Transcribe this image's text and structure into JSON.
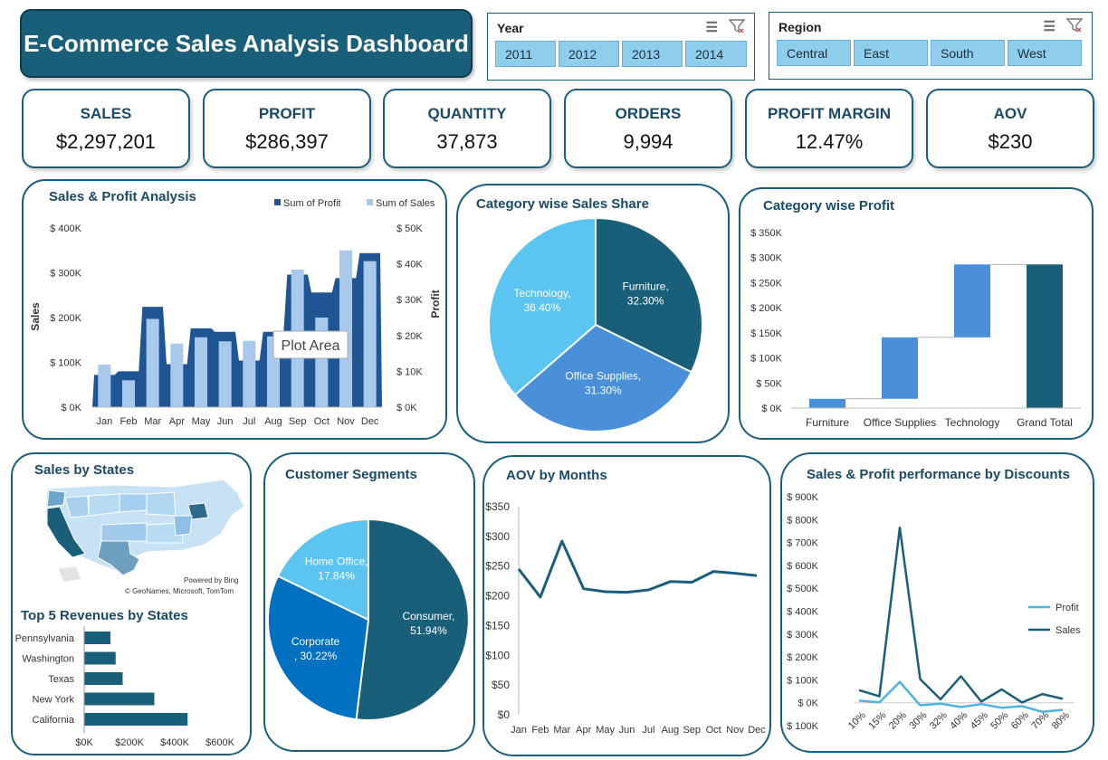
{
  "header": {
    "title": "E-Commerce Sales Analysis Dashboard"
  },
  "slicers": {
    "year": {
      "label": "Year",
      "items": [
        "2011",
        "2012",
        "2013",
        "2014"
      ]
    },
    "region": {
      "label": "Region",
      "items": [
        "Central",
        "East",
        "South",
        "West"
      ]
    }
  },
  "kpis": [
    {
      "label": "SALES",
      "value": "$2,297,201"
    },
    {
      "label": "PROFIT",
      "value": "$286,397"
    },
    {
      "label": "QUANTITY",
      "value": "37,873"
    },
    {
      "label": "ORDERS",
      "value": "9,994"
    },
    {
      "label": "PROFIT MARGIN",
      "value": "12.47%"
    },
    {
      "label": "AOV",
      "value": "$230"
    }
  ],
  "panels": {
    "sales_profit": "Sales & Profit Analysis",
    "category_share": "Category wise Sales Share",
    "category_profit": "Category wise Profit",
    "states": "Sales by States",
    "top5": "Top 5 Revenues by States",
    "segments": "Customer Segments",
    "aov": "AOV by Months",
    "discounts": "Sales & Profit performance by Discounts"
  },
  "map": {
    "credit1": "Powered by Bing",
    "credit2": "© GeoNames, Microsoft, TomTom"
  },
  "tooltip": "Plot Area",
  "colors": {
    "dark": "#1a5f7a",
    "navy": "#1f5592",
    "light": "#a9c9ec",
    "mid": "#4a90d9",
    "sky": "#5bc4f0",
    "blue": "#0070c0"
  },
  "chart_data": [
    {
      "id": "sales_profit",
      "type": "bar",
      "title": "Sales & Profit Analysis",
      "categories": [
        "Jan",
        "Feb",
        "Mar",
        "Apr",
        "May",
        "Jun",
        "Jul",
        "Aug",
        "Sep",
        "Oct",
        "Nov",
        "Dec"
      ],
      "series": [
        {
          "name": "Sum of Sales",
          "axis": "left",
          "values": [
            95000,
            60000,
            197000,
            142000,
            156000,
            147000,
            148000,
            158000,
            307000,
            200000,
            350000,
            326000
          ]
        },
        {
          "name": "Sum of Profit",
          "axis": "right",
          "values": [
            9000,
            10000,
            28000,
            12000,
            22000,
            21000,
            13000,
            21000,
            37000,
            32000,
            36000,
            43000
          ]
        }
      ],
      "ylabel": "Sales",
      "y2label": "Profit",
      "ylim": [
        0,
        400000
      ],
      "y2lim": [
        0,
        50000
      ],
      "yticks": [
        "$ 0K",
        "$ 100K",
        "$ 200K",
        "$ 300K",
        "$ 400K"
      ],
      "y2ticks": [
        "$ 0K",
        "$ 10K",
        "$ 20K",
        "$ 30K",
        "$ 40K",
        "$ 50K"
      ],
      "legend": "top-right"
    },
    {
      "id": "category_share",
      "type": "pie",
      "title": "Category wise Sales Share",
      "labels": [
        "Furniture",
        "Office Supplies",
        "Technology"
      ],
      "values": [
        32.3,
        31.3,
        36.4
      ],
      "display": [
        "Furniture,\n32.30%",
        "Office Supplies,\n31.30%",
        "Technology,\n36.40%"
      ]
    },
    {
      "id": "category_profit",
      "type": "bar",
      "subtype": "waterfall",
      "title": "Category wise Profit",
      "categories": [
        "Furniture",
        "Office Supplies",
        "Technology",
        "Grand Total"
      ],
      "values": [
        18451,
        122491,
        145455,
        286397
      ],
      "ylim": [
        0,
        350000
      ],
      "yticks": [
        "$ 0K",
        "$ 50K",
        "$ 100K",
        "$ 150K",
        "$ 200K",
        "$ 250K",
        "$ 300K",
        "$ 350K"
      ]
    },
    {
      "id": "top5_states",
      "type": "bar",
      "orientation": "horizontal",
      "title": "Top 5 Revenues by States",
      "categories": [
        "Pennsylvania",
        "Washington",
        "Texas",
        "New York",
        "California"
      ],
      "values": [
        116000,
        139000,
        170000,
        310000,
        457000
      ],
      "xlim": [
        0,
        600000
      ],
      "xticks": [
        "$0K",
        "$200K",
        "$400K",
        "$600K"
      ]
    },
    {
      "id": "segments",
      "type": "pie",
      "title": "Customer Segments",
      "labels": [
        "Consumer",
        "Corporate",
        "Home Office"
      ],
      "values": [
        51.94,
        30.22,
        17.84
      ],
      "display": [
        "Consumer,\n51.94%",
        "Corporate\n, 30.22%",
        "Home Office,\n17.84%"
      ]
    },
    {
      "id": "aov",
      "type": "line",
      "title": "AOV by Months",
      "categories": [
        "Jan",
        "Feb",
        "Mar",
        "Apr",
        "May",
        "Jun",
        "Jul",
        "Aug",
        "Sep",
        "Oct",
        "Nov",
        "Dec"
      ],
      "values": [
        245,
        198,
        292,
        212,
        207,
        206,
        210,
        224,
        223,
        241,
        238,
        234
      ],
      "ylim": [
        0,
        350
      ],
      "yticks": [
        "$0",
        "$50",
        "$100",
        "$150",
        "$200",
        "$250",
        "$300",
        "$350"
      ]
    },
    {
      "id": "discounts",
      "type": "line",
      "title": "Sales & Profit performance by Discounts",
      "categories": [
        "10%",
        "15%",
        "20%",
        "30%",
        "32%",
        "40%",
        "45%",
        "50%",
        "60%",
        "70%",
        "80%"
      ],
      "series": [
        {
          "name": "Profit",
          "values": [
            9000,
            2000,
            91000,
            -11000,
            -4000,
            -19000,
            -6000,
            -22000,
            -15000,
            -40000,
            -31000
          ]
        },
        {
          "name": "Sales",
          "values": [
            55000,
            28000,
            765000,
            103000,
            15000,
            116000,
            5000,
            58000,
            1000,
            38000,
            17000
          ]
        }
      ],
      "ylim": [
        -100000,
        900000
      ],
      "yticks": [
        "$ 100K",
        "$ 0K",
        "$ 100K",
        "$ 200K",
        "$ 300K",
        "$ 400K",
        "$ 500K",
        "$ 600K",
        "$ 700K",
        "$ 800K",
        "$ 900K"
      ],
      "legend": "right"
    }
  ]
}
